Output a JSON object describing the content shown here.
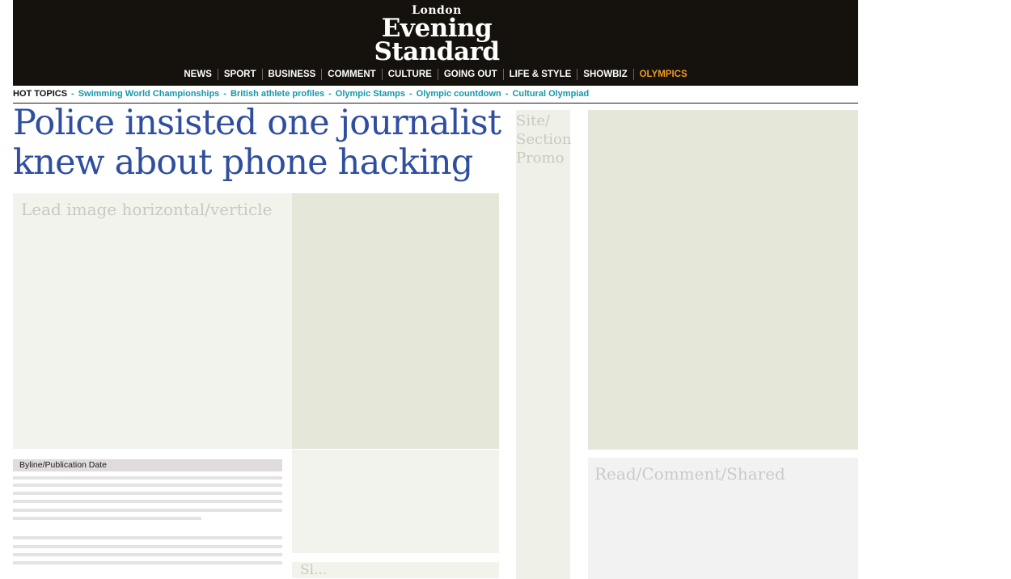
{
  "masthead": {
    "logo_small": "London",
    "logo_line1": "Evening",
    "logo_line2": "Standard",
    "nav": [
      "NEWS",
      "SPORT",
      "BUSINESS",
      "COMMENT",
      "CULTURE",
      "GOING OUT",
      "LIFE & STYLE",
      "SHOWBIZ",
      "OLYMPICS"
    ],
    "accent_item": "OLYMPICS",
    "colors": {
      "background": "#15110d",
      "nav_text": "#ffffff",
      "accent": "#f09a1f"
    }
  },
  "hot_topics": {
    "label": "HOT TOPICS",
    "links": [
      "Swimming World Championships",
      "British athlete profiles",
      "Olympic Stamps",
      "Olympic countdown",
      "Cultural Olympiad"
    ],
    "link_color": "#1596a8"
  },
  "article": {
    "headline_line1": "Police insisted one journalist",
    "headline_line2": "knew about phone hacking",
    "headline_color": "#2f4ea0",
    "lead_image_label": "Lead image horizontal/verticle",
    "byline_label": "Byline/Publication Date",
    "side_bottom_label": "Sl..."
  },
  "sidebar": {
    "promo_line1": "Site/",
    "promo_line2": "Section",
    "promo_line3": "Promo",
    "read_comment_shared": "Read/Comment/Shared"
  }
}
